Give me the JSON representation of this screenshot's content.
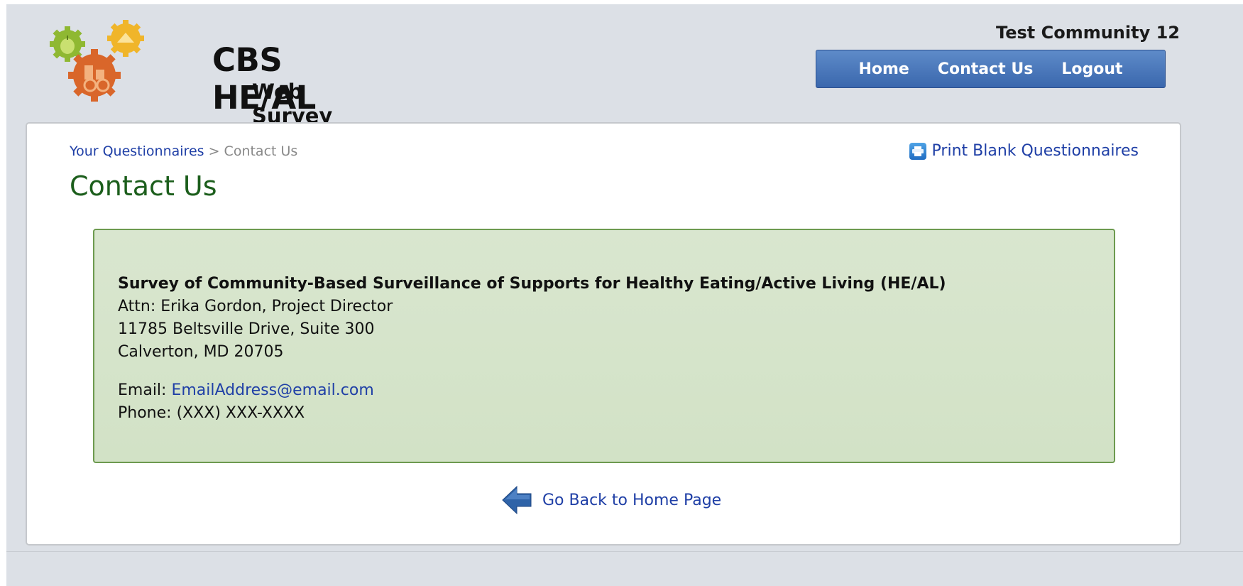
{
  "header": {
    "logo_title": "CBS HE/AL",
    "logo_subtitle": "Web Survey",
    "community_name": "Test Community 12",
    "nav": [
      {
        "label": "Home"
      },
      {
        "label": "Contact Us"
      },
      {
        "label": "Logout"
      }
    ]
  },
  "breadcrumb": {
    "root": "Your Questionnaires",
    "separator": ">",
    "current": "Contact Us"
  },
  "print_link": {
    "label": "Print Blank Questionnaires",
    "icon": "printer-icon"
  },
  "page_title": "Contact Us",
  "contact": {
    "org": "Survey of Community-Based Surveillance of Supports for Healthy Eating/Active Living (HE/AL)",
    "attn": "Attn: Erika Gordon, Project Director",
    "address1": "11785 Beltsville Drive, Suite 300",
    "address2": "Calverton, MD 20705",
    "email_label": "Email:",
    "email": "EmailAddress@email.com",
    "phone_label": "Phone:",
    "phone": "(XXX) XXX-XXXX"
  },
  "back_link": {
    "label": "Go Back to Home Page",
    "icon": "back-arrow-icon"
  },
  "colors": {
    "nav_blue": "#3a67ad",
    "title_green": "#1c5e1c",
    "link_blue": "#1f3fa6",
    "info_bg": "#d9e6cf",
    "info_border": "#6d9a4f"
  }
}
